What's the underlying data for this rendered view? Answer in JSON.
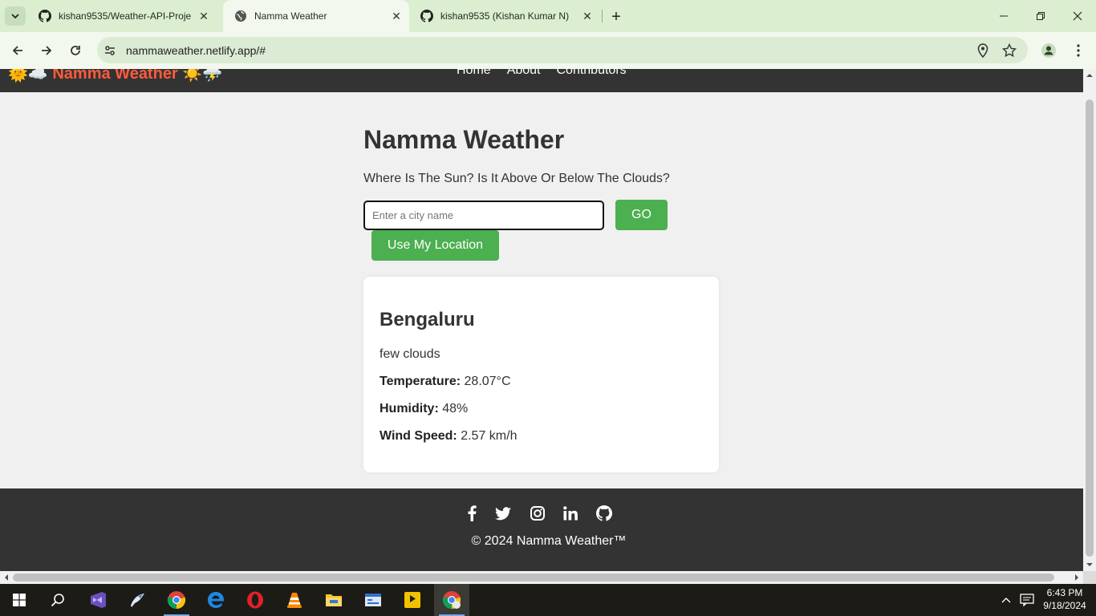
{
  "browser": {
    "tabs": [
      {
        "title": "kishan9535/Weather-API-Proje",
        "favicon": "github-icon"
      },
      {
        "title": "Namma Weather",
        "favicon": "globe-icon",
        "active": true
      },
      {
        "title": "kishan9535 (Kishan Kumar N)",
        "favicon": "github-icon"
      }
    ],
    "url": "nammaweather.netlify.app/#"
  },
  "site": {
    "brand": "🌞☁️ Namma Weather ☀️⛈️",
    "nav": [
      "Home",
      "About",
      "Contributors"
    ],
    "heading": "Namma Weather",
    "subheading": "Where Is The Sun? Is It Above Or Below The Clouds?",
    "search_placeholder": "Enter a city name",
    "go_label": "GO",
    "location_label": "Use My Location",
    "weather": {
      "city": "Bengaluru",
      "description": "few clouds",
      "temperature_label": "Temperature:",
      "temperature_value": "28.07°C",
      "humidity_label": "Humidity:",
      "humidity_value": "48%",
      "wind_label": "Wind Speed:",
      "wind_value": "2.57 km/h"
    },
    "footer": {
      "social": [
        "facebook-icon",
        "twitter-icon",
        "instagram-icon",
        "linkedin-icon",
        "github-icon"
      ],
      "copyright": "© 2024 Namma Weather™"
    },
    "colors": {
      "accent": "#4caf50",
      "brand": "#ff5a3c",
      "nav_bg": "#333333"
    }
  },
  "taskbar": {
    "time": "6:43 PM",
    "date": "9/18/2024"
  }
}
